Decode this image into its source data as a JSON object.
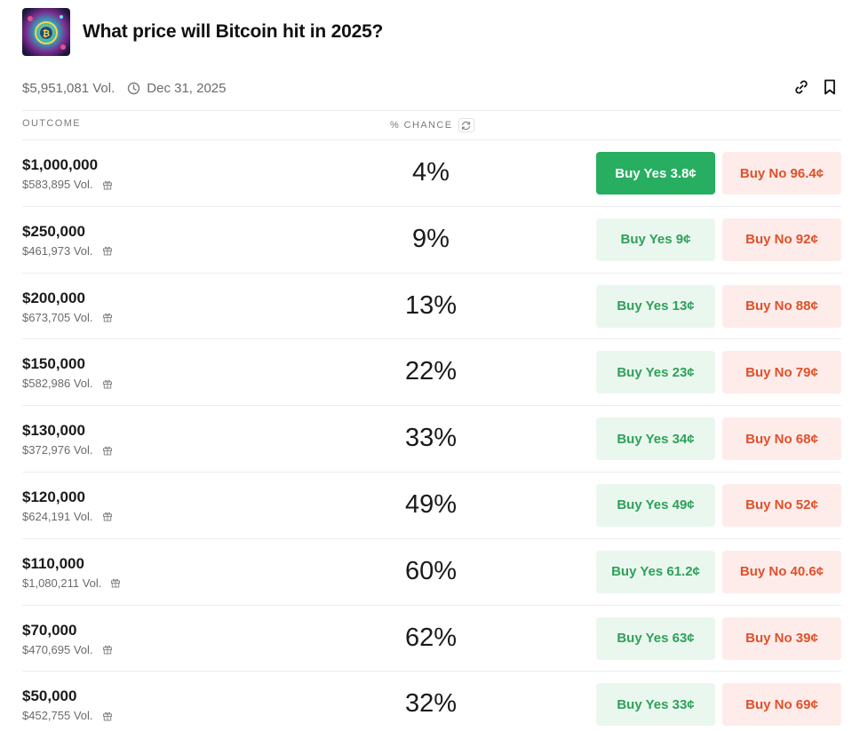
{
  "header": {
    "title": "What price will Bitcoin hit in 2025?"
  },
  "meta": {
    "volume": "$5,951,081 Vol.",
    "end_date": "Dec 31, 2025"
  },
  "columns": {
    "outcome": "OUTCOME",
    "chance": "% CHANCE"
  },
  "colors": {
    "yes_bg": "#eaf7ee",
    "yes_text": "#2fa05a",
    "yes_active_bg": "#27ae60",
    "no_bg": "#fdecea",
    "no_text": "#e0502a"
  },
  "outcomes": [
    {
      "label": "$1,000,000",
      "volume": "$583,895 Vol.",
      "chance": "4%",
      "yes": "Buy Yes 3.8¢",
      "no": "Buy No 96.4¢"
    },
    {
      "label": "$250,000",
      "volume": "$461,973 Vol.",
      "chance": "9%",
      "yes": "Buy Yes 9¢",
      "no": "Buy No 92¢"
    },
    {
      "label": "$200,000",
      "volume": "$673,705 Vol.",
      "chance": "13%",
      "yes": "Buy Yes 13¢",
      "no": "Buy No 88¢"
    },
    {
      "label": "$150,000",
      "volume": "$582,986 Vol.",
      "chance": "22%",
      "yes": "Buy Yes 23¢",
      "no": "Buy No 79¢"
    },
    {
      "label": "$130,000",
      "volume": "$372,976 Vol.",
      "chance": "33%",
      "yes": "Buy Yes 34¢",
      "no": "Buy No 68¢"
    },
    {
      "label": "$120,000",
      "volume": "$624,191 Vol.",
      "chance": "49%",
      "yes": "Buy Yes 49¢",
      "no": "Buy No 52¢"
    },
    {
      "label": "$110,000",
      "volume": "$1,080,211 Vol.",
      "chance": "60%",
      "yes": "Buy Yes 61.2¢",
      "no": "Buy No 40.6¢"
    },
    {
      "label": "$70,000",
      "volume": "$470,695 Vol.",
      "chance": "62%",
      "yes": "Buy Yes 63¢",
      "no": "Buy No 39¢"
    },
    {
      "label": "$50,000",
      "volume": "$452,755 Vol.",
      "chance": "32%",
      "yes": "Buy Yes 33¢",
      "no": "Buy No 69¢"
    }
  ]
}
